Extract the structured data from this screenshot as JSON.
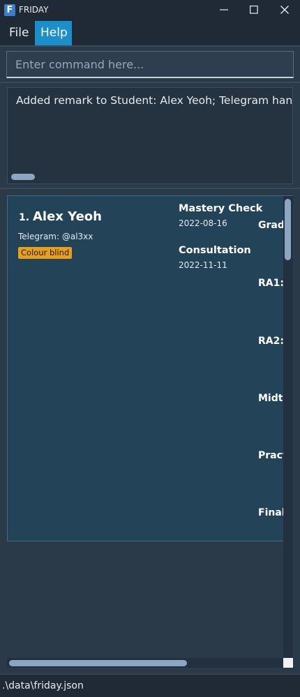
{
  "window": {
    "title": "FRIDAY",
    "icon_letter": "F"
  },
  "menu": {
    "file": "File",
    "help": "Help"
  },
  "command": {
    "placeholder": "Enter command here..."
  },
  "result": {
    "text": "Added remark to Student: Alex Yeoh; Telegram handle"
  },
  "students": [
    {
      "index": "1.",
      "name": "Alex Yeoh",
      "telegram": "Telegram: @al3xx",
      "tags": [
        "Colour blind"
      ],
      "events": [
        {
          "title": "Mastery Check",
          "date": "2022-08-16"
        },
        {
          "title": "Consultation",
          "date": "2022-11-11"
        }
      ],
      "grades": [
        "Grade",
        "RA1:",
        "RA2:",
        "Midte",
        "Pract",
        "Finals"
      ]
    }
  ],
  "status": {
    "path": ".\\data\\friday.json"
  },
  "colors": {
    "accent": "#1a8fc9",
    "tag": "#e8a01a",
    "card": "#224358",
    "background": "#2b3a48"
  }
}
